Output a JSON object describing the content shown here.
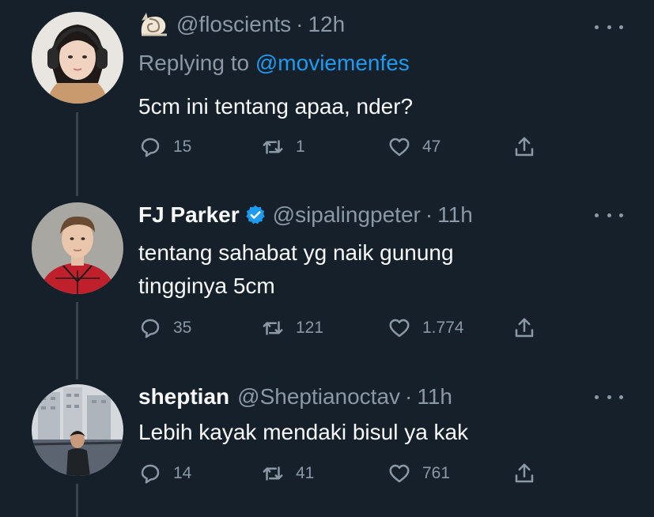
{
  "tweets": [
    {
      "name": "",
      "handle": "@floscients",
      "time": "12h",
      "replying_label": "Replying to",
      "replying_to": "@moviemenfes",
      "lines": [
        "5cm ini tentang apaa, nder?"
      ],
      "replies": "15",
      "retweets": "1",
      "likes": "47",
      "header_icon": "shell-emoji-icon"
    },
    {
      "name": "FJ Parker",
      "verified": true,
      "handle": "@sipalingpeter",
      "time": "11h",
      "lines": [
        "tentang sahabat yg naik gunung",
        "tingginya 5cm"
      ],
      "replies": "35",
      "retweets": "121",
      "likes": "1.774"
    },
    {
      "name": "sheptian",
      "handle": "@Sheptianoctav",
      "time": "11h",
      "lines": [
        "Lebih kayak mendaki bisul ya kak"
      ],
      "replies": "14",
      "retweets": "41",
      "likes": "761"
    }
  ],
  "separator": "·",
  "colors": {
    "background": "#15202b",
    "text": "#f7f9f9",
    "muted": "#8b98a5",
    "accent": "#1d9bf0",
    "thread_line": "#38444d"
  }
}
